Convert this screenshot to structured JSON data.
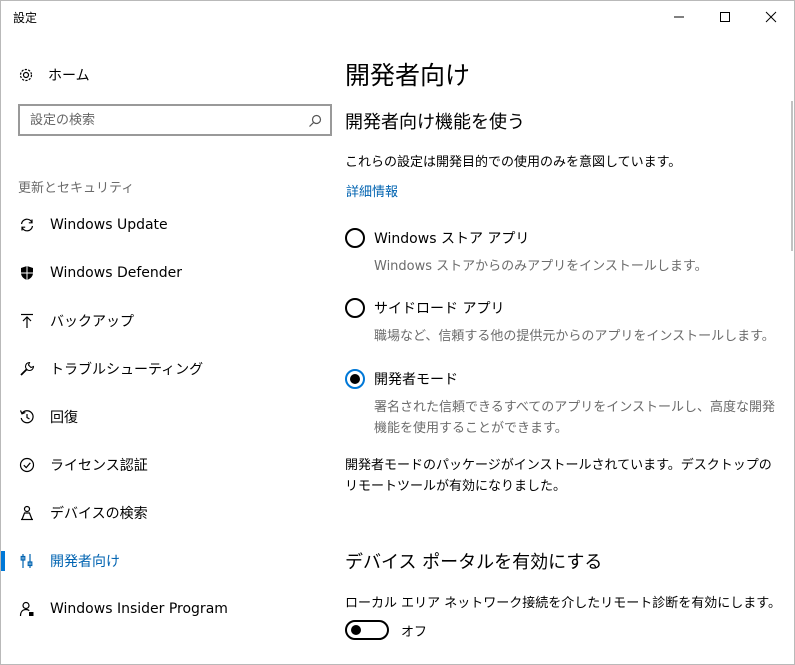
{
  "window": {
    "title": "設定"
  },
  "sidebar": {
    "home_label": "ホーム",
    "search_placeholder": "設定の検索",
    "section_label": "更新とセキュリティ",
    "items": [
      {
        "label": "Windows Update",
        "icon": "sync-icon"
      },
      {
        "label": "Windows Defender",
        "icon": "shield-icon"
      },
      {
        "label": "バックアップ",
        "icon": "backup-arrow-icon"
      },
      {
        "label": "トラブルシューティング",
        "icon": "wrench-icon"
      },
      {
        "label": "回復",
        "icon": "recovery-icon"
      },
      {
        "label": "ライセンス認証",
        "icon": "check-circle-icon"
      },
      {
        "label": "デバイスの検索",
        "icon": "person-find-icon"
      },
      {
        "label": "開発者向け",
        "icon": "developer-tools-icon",
        "selected": true
      },
      {
        "label": "Windows Insider Program",
        "icon": "insider-icon"
      }
    ]
  },
  "main": {
    "page_title": "開発者向け",
    "section1_title": "開発者向け機能を使う",
    "section1_desc": "これらの設定は開発目的での使用のみを意図しています。",
    "more_info_link": "詳細情報",
    "options": [
      {
        "label": "Windows ストア アプリ",
        "desc": "Windows ストアからのみアプリをインストールします。",
        "checked": false
      },
      {
        "label": "サイドロード アプリ",
        "desc": "職場など、信頼する他の提供元からのアプリをインストールします。",
        "checked": false
      },
      {
        "label": "開発者モード",
        "desc": "署名された信頼できるすべてのアプリをインストールし、高度な開発機能を使用することができます。",
        "checked": true
      }
    ],
    "dev_mode_status": "開発者モードのパッケージがインストールされています。デスクトップのリモートツールが有効になりました。",
    "section2_title": "デバイス ポータルを有効にする",
    "section2_desc": "ローカル エリア ネットワーク接続を介したリモート診断を有効にします。",
    "toggle_state": "オフ"
  },
  "colors": {
    "accent": "#0078d7",
    "link": "#0063b1",
    "secondary_text": "#6b6b6b"
  }
}
